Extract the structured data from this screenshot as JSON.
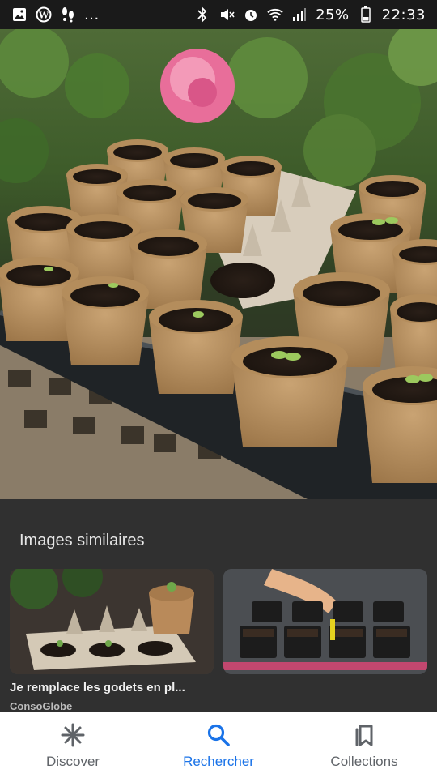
{
  "status_bar": {
    "left_icons": [
      "gallery-icon",
      "wordpress-icon",
      "footprint-icon"
    ],
    "left_more": "...",
    "battery": "25%",
    "time": "22:33",
    "right_icons": [
      "bluetooth-icon",
      "mute-icon",
      "alarm-icon",
      "wifi-icon",
      "signal-icon",
      "battery-icon"
    ]
  },
  "hero": {
    "image_description_icon": "seedling-pots-photo"
  },
  "similar": {
    "title": "Images similaires",
    "items": [
      {
        "caption": "Je remplace les godets en pl...",
        "source": "ConsoGlobe"
      },
      {
        "caption": "",
        "source": ""
      }
    ]
  },
  "bottom_nav": {
    "items": [
      {
        "label": "Discover",
        "icon": "asterisk-icon"
      },
      {
        "label": "Rechercher",
        "icon": "search-icon"
      },
      {
        "label": "Collections",
        "icon": "bookmarks-icon"
      }
    ],
    "active_index": 1,
    "colors": {
      "active": "#1a73e8",
      "inactive": "#5f6368"
    }
  }
}
